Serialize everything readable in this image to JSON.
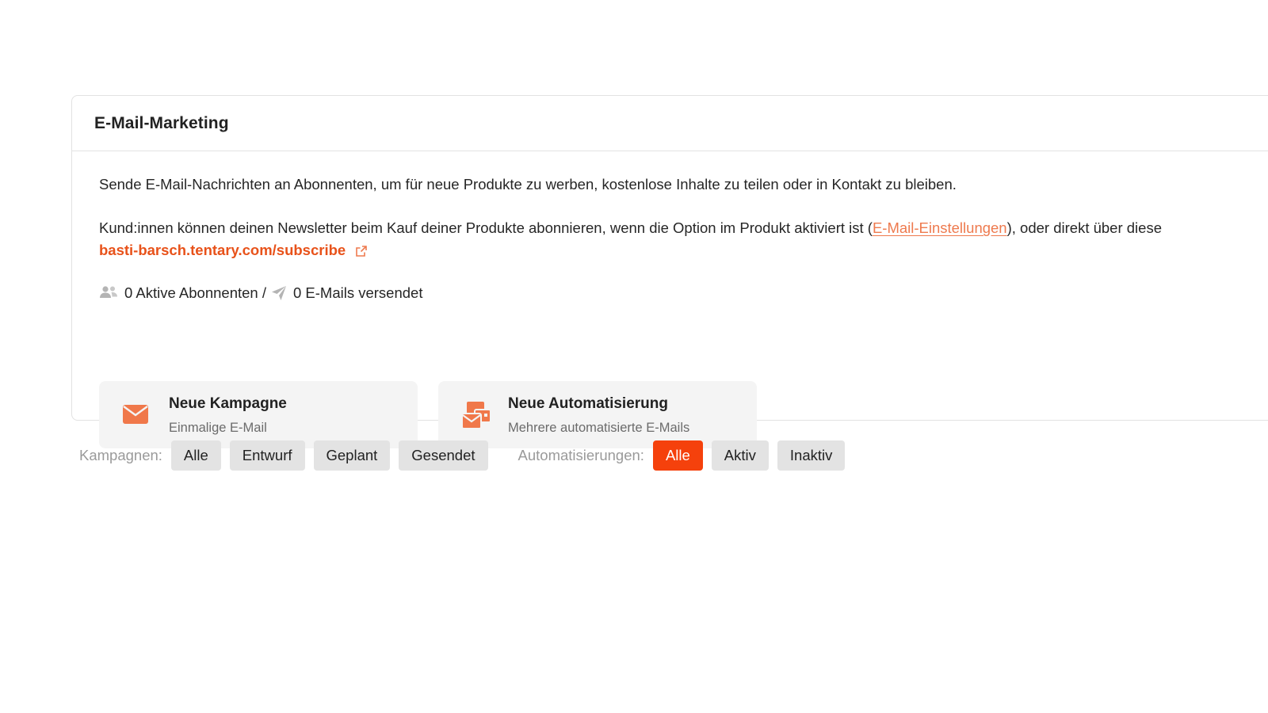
{
  "panel": {
    "title": "E-Mail-Marketing",
    "description": "Sende E-Mail-Nachrichten an Abonnenten, um für neue Produkte zu werben, kostenlose Inhalte zu teilen oder in Kontakt zu bleiben.",
    "subscribe_text_before": "Kund:innen können deinen Newsletter beim Kauf deiner Produkte abonnieren, wenn die Option im Produkt aktiviert ist (",
    "settings_link": "E-Mail-Einstellungen",
    "subscribe_text_after": "), oder direkt über diese",
    "subscribe_url": "basti-barsch.tentary.com/subscribe",
    "stats": {
      "subscribers": "0 Aktive Abonnenten /",
      "emails_sent": "0 E-Mails versendet"
    }
  },
  "actions": {
    "campaign": {
      "title": "Neue Kampagne",
      "subtitle": "Einmalige E-Mail",
      "icon": "envelope-icon"
    },
    "automation": {
      "title": "Neue Automatisierung",
      "subtitle": "Mehrere automatisierte E-Mails",
      "icon": "multiple-envelopes-icon"
    }
  },
  "filters": {
    "campaigns_label": "Kampagnen:",
    "campaigns": [
      {
        "label": "Alle",
        "active": false
      },
      {
        "label": "Entwurf",
        "active": false
      },
      {
        "label": "Geplant",
        "active": false
      },
      {
        "label": "Gesendet",
        "active": false
      }
    ],
    "automations_label": "Automatisierungen:",
    "automations": [
      {
        "label": "Alle",
        "active": true
      },
      {
        "label": "Aktiv",
        "active": false
      },
      {
        "label": "Inaktiv",
        "active": false
      }
    ]
  },
  "colors": {
    "accent": "#f5410c",
    "link": "#e8521a",
    "icon": "#f0784a"
  }
}
